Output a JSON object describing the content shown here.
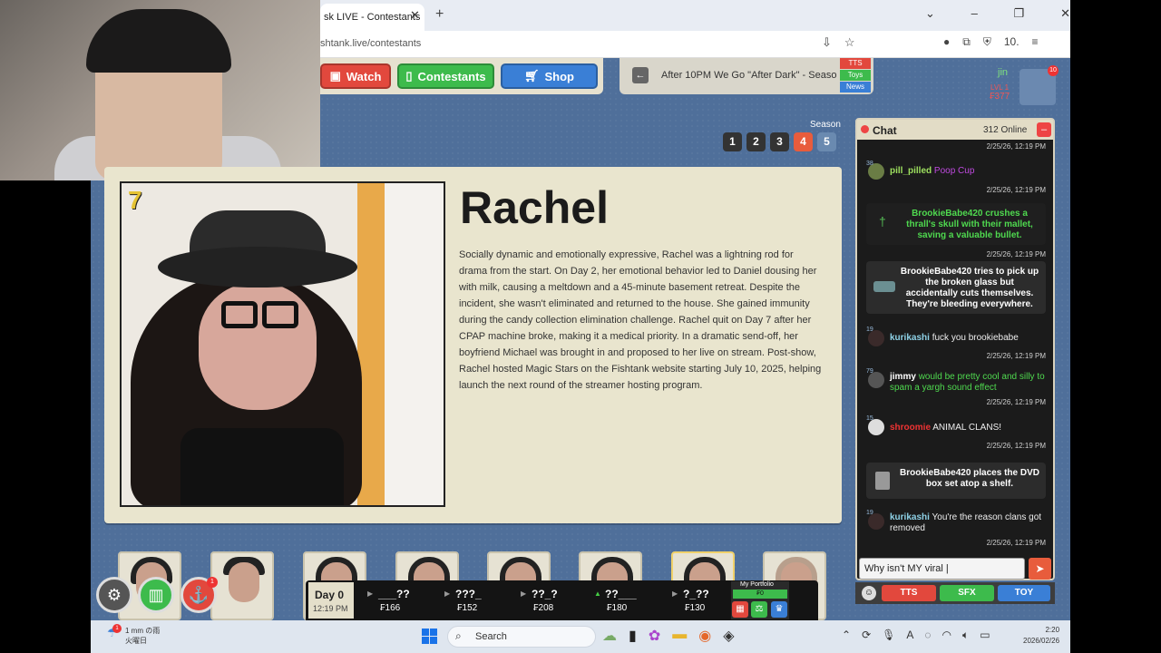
{
  "browser": {
    "tab_title": "sk LIVE - Contestants",
    "url": "shtank.live/contestants",
    "win_controls": [
      "⌄",
      "–",
      "❐",
      "✕"
    ]
  },
  "nav": {
    "watch": "Watch",
    "contestants": "Contestants",
    "shop": "Shop",
    "episode_title": "After 10PM We Go \"After Dark\" - Seaso...",
    "tags": [
      "TTS",
      "Toys",
      "News"
    ]
  },
  "user": {
    "name": "jin",
    "level": "LVL 1",
    "coins": "₣377",
    "badge": "10"
  },
  "season": {
    "label": "Season",
    "options": [
      "1",
      "2",
      "3",
      "4",
      "5"
    ],
    "selected": "4"
  },
  "contestant": {
    "number": "7",
    "name": "Rachel",
    "bio": "Socially dynamic and emotionally expressive, Rachel was a lightning rod for drama from the start. On Day 2, her emotional behavior led to Daniel dousing her with milk, causing a meltdown and a 45-minute basement retreat. Despite the incident, she wasn't eliminated and returned to the house. She gained immunity during the candy collection elimination challenge. Rachel quit on Day 7 after her CPAP machine broke, making it a medical priority. In a dramatic send-off, her boyfriend Michael was brought in and proposed to her live on stream. Post-show, Rachel hosted Magic Stars on the Fishtank website starting July 10, 2025, helping launch the next round of the streamer hosting program."
  },
  "chat": {
    "title": "Chat",
    "online": "312 Online",
    "timestamp": "2/25/26, 12:19 PM",
    "messages": [
      {
        "level": "38",
        "user": "pill_pilled",
        "text": "Poop Cup"
      },
      {
        "system": "BrookieBabe420 crushes a thrall's skull with their mallet, saving a valuable bullet."
      },
      {
        "system": "BrookieBabe420 tries to pick up the broken glass but accidentally cuts themselves. They're bleeding everywhere."
      },
      {
        "level": "19",
        "user": "kurikashi",
        "text": "fuck you brookiebabe"
      },
      {
        "level": "79",
        "user": "jimmy",
        "text": "would be pretty cool and silly to spam a yargh sound effect"
      },
      {
        "level": "15",
        "user": "shroomie",
        "text": "ANIMAL CLANS!"
      },
      {
        "system": "BrookieBabe420 places the DVD box set atop a shelf."
      },
      {
        "level": "19",
        "user": "kurikashi",
        "text": "You're the reason clans got removed"
      }
    ],
    "input_value": "Why isn't MY viral |",
    "tts": "TTS",
    "sfx": "SFX",
    "toy": "TOY"
  },
  "bottom": {
    "day": "Day 0",
    "time": "12:19 PM",
    "stocks": [
      {
        "name": "___??",
        "value": "₣166",
        "dir": "down"
      },
      {
        "name": "???_",
        "value": "₣152",
        "dir": "down"
      },
      {
        "name": "??_?",
        "value": "₣208",
        "dir": "down"
      },
      {
        "name": "??___",
        "value": "₣180",
        "dir": "up"
      },
      {
        "name": "?_??",
        "value": "₣130",
        "dir": "down"
      }
    ],
    "portfolio_label": "My Portfolio",
    "portfolio_value": "₣0",
    "red_badge": "1"
  },
  "taskbar": {
    "weather_line1": "1 mm の雨",
    "weather_line2": "火曜日",
    "weather_badge": "1",
    "search": "Search",
    "time": "2:20",
    "date": "2026/02/26"
  },
  "colors": {
    "page_bg": "#4f6f9a",
    "accent_red": "#e2483d",
    "accent_green": "#3dbb4c",
    "accent_blue": "#3a7fd6",
    "card_bg": "#e9e5ce"
  }
}
